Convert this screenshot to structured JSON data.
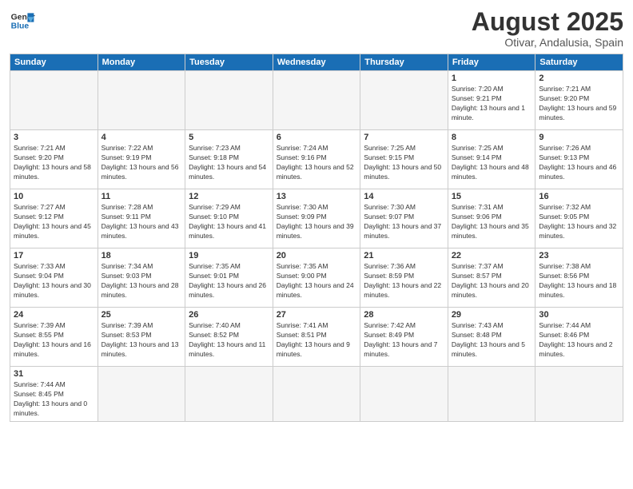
{
  "header": {
    "logo_general": "General",
    "logo_blue": "Blue",
    "month_title": "August 2025",
    "location": "Otivar, Andalusia, Spain"
  },
  "weekdays": [
    "Sunday",
    "Monday",
    "Tuesday",
    "Wednesday",
    "Thursday",
    "Friday",
    "Saturday"
  ],
  "weeks": [
    [
      {
        "day": "",
        "empty": true
      },
      {
        "day": "",
        "empty": true
      },
      {
        "day": "",
        "empty": true
      },
      {
        "day": "",
        "empty": true
      },
      {
        "day": "",
        "empty": true
      },
      {
        "day": "1",
        "sunrise": "7:20 AM",
        "sunset": "9:21 PM",
        "daylight": "13 hours and 1 minute"
      },
      {
        "day": "2",
        "sunrise": "7:21 AM",
        "sunset": "9:20 PM",
        "daylight": "13 hours and 59 minutes"
      }
    ],
    [
      {
        "day": "3",
        "sunrise": "7:21 AM",
        "sunset": "9:20 PM",
        "daylight": "13 hours and 58 minutes"
      },
      {
        "day": "4",
        "sunrise": "7:22 AM",
        "sunset": "9:19 PM",
        "daylight": "13 hours and 56 minutes"
      },
      {
        "day": "5",
        "sunrise": "7:23 AM",
        "sunset": "9:18 PM",
        "daylight": "13 hours and 54 minutes"
      },
      {
        "day": "6",
        "sunrise": "7:24 AM",
        "sunset": "9:16 PM",
        "daylight": "13 hours and 52 minutes"
      },
      {
        "day": "7",
        "sunrise": "7:25 AM",
        "sunset": "9:15 PM",
        "daylight": "13 hours and 50 minutes"
      },
      {
        "day": "8",
        "sunrise": "7:25 AM",
        "sunset": "9:14 PM",
        "daylight": "13 hours and 48 minutes"
      },
      {
        "day": "9",
        "sunrise": "7:26 AM",
        "sunset": "9:13 PM",
        "daylight": "13 hours and 46 minutes"
      }
    ],
    [
      {
        "day": "10",
        "sunrise": "7:27 AM",
        "sunset": "9:12 PM",
        "daylight": "13 hours and 45 minutes"
      },
      {
        "day": "11",
        "sunrise": "7:28 AM",
        "sunset": "9:11 PM",
        "daylight": "13 hours and 43 minutes"
      },
      {
        "day": "12",
        "sunrise": "7:29 AM",
        "sunset": "9:10 PM",
        "daylight": "13 hours and 41 minutes"
      },
      {
        "day": "13",
        "sunrise": "7:30 AM",
        "sunset": "9:09 PM",
        "daylight": "13 hours and 39 minutes"
      },
      {
        "day": "14",
        "sunrise": "7:30 AM",
        "sunset": "9:07 PM",
        "daylight": "13 hours and 37 minutes"
      },
      {
        "day": "15",
        "sunrise": "7:31 AM",
        "sunset": "9:06 PM",
        "daylight": "13 hours and 35 minutes"
      },
      {
        "day": "16",
        "sunrise": "7:32 AM",
        "sunset": "9:05 PM",
        "daylight": "13 hours and 32 minutes"
      }
    ],
    [
      {
        "day": "17",
        "sunrise": "7:33 AM",
        "sunset": "9:04 PM",
        "daylight": "13 hours and 30 minutes"
      },
      {
        "day": "18",
        "sunrise": "7:34 AM",
        "sunset": "9:03 PM",
        "daylight": "13 hours and 28 minutes"
      },
      {
        "day": "19",
        "sunrise": "7:35 AM",
        "sunset": "9:01 PM",
        "daylight": "13 hours and 26 minutes"
      },
      {
        "day": "20",
        "sunrise": "7:35 AM",
        "sunset": "9:00 PM",
        "daylight": "13 hours and 24 minutes"
      },
      {
        "day": "21",
        "sunrise": "7:36 AM",
        "sunset": "8:59 PM",
        "daylight": "13 hours and 22 minutes"
      },
      {
        "day": "22",
        "sunrise": "7:37 AM",
        "sunset": "8:57 PM",
        "daylight": "13 hours and 20 minutes"
      },
      {
        "day": "23",
        "sunrise": "7:38 AM",
        "sunset": "8:56 PM",
        "daylight": "13 hours and 18 minutes"
      }
    ],
    [
      {
        "day": "24",
        "sunrise": "7:39 AM",
        "sunset": "8:55 PM",
        "daylight": "13 hours and 16 minutes"
      },
      {
        "day": "25",
        "sunrise": "7:39 AM",
        "sunset": "8:53 PM",
        "daylight": "13 hours and 13 minutes"
      },
      {
        "day": "26",
        "sunrise": "7:40 AM",
        "sunset": "8:52 PM",
        "daylight": "13 hours and 11 minutes"
      },
      {
        "day": "27",
        "sunrise": "7:41 AM",
        "sunset": "8:51 PM",
        "daylight": "13 hours and 9 minutes"
      },
      {
        "day": "28",
        "sunrise": "7:42 AM",
        "sunset": "8:49 PM",
        "daylight": "13 hours and 7 minutes"
      },
      {
        "day": "29",
        "sunrise": "7:43 AM",
        "sunset": "8:48 PM",
        "daylight": "13 hours and 5 minutes"
      },
      {
        "day": "30",
        "sunrise": "7:44 AM",
        "sunset": "8:46 PM",
        "daylight": "13 hours and 2 minutes"
      }
    ],
    [
      {
        "day": "31",
        "sunrise": "7:44 AM",
        "sunset": "8:45 PM",
        "daylight": "13 hours and 0 minutes"
      },
      {
        "day": "",
        "empty": true
      },
      {
        "day": "",
        "empty": true
      },
      {
        "day": "",
        "empty": true
      },
      {
        "day": "",
        "empty": true
      },
      {
        "day": "",
        "empty": true
      },
      {
        "day": "",
        "empty": true
      }
    ]
  ]
}
